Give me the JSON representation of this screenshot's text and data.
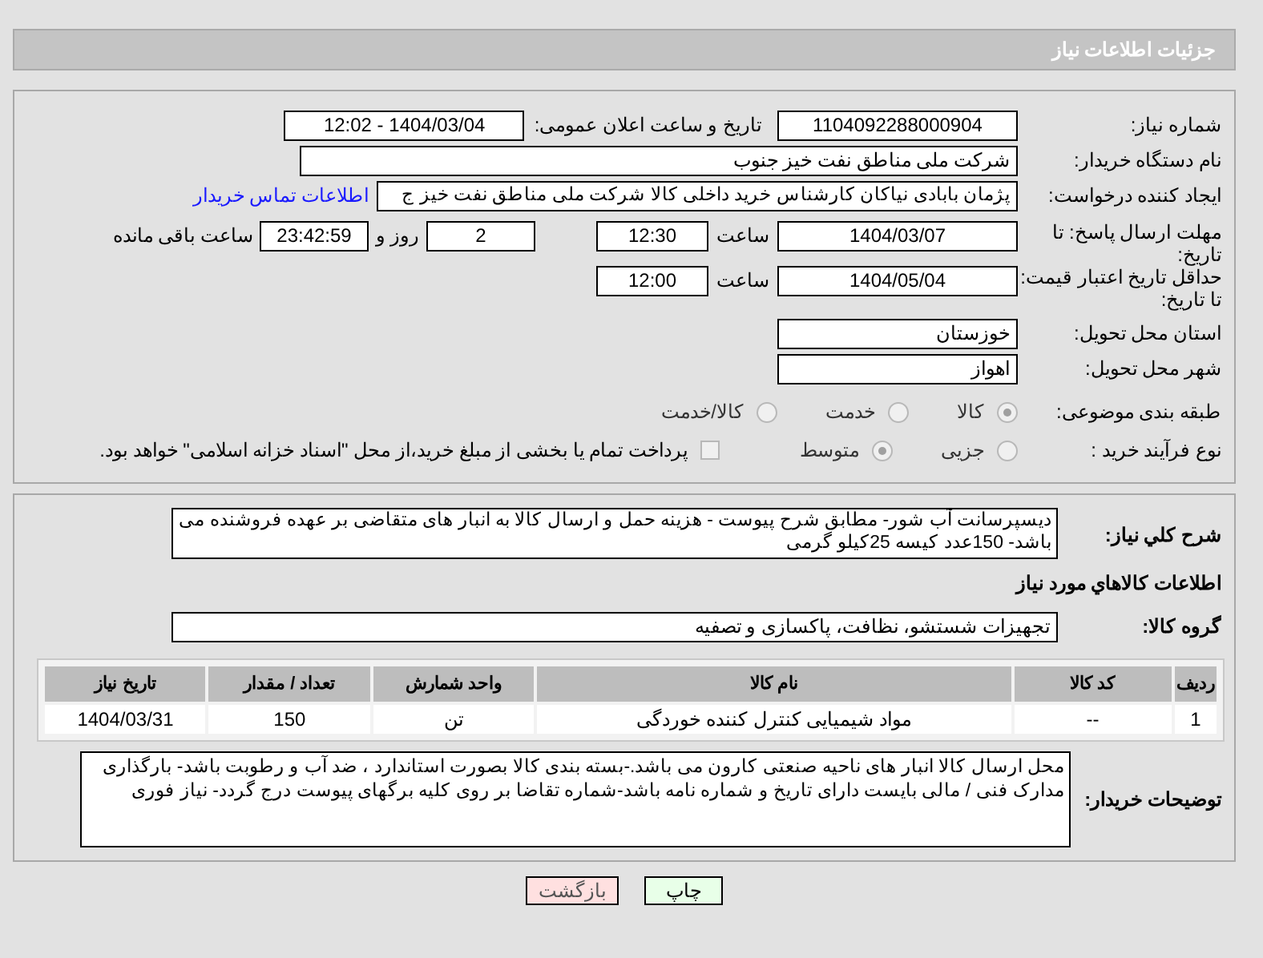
{
  "header": {
    "title": "جزئیات اطلاعات نیاز"
  },
  "need_number": {
    "label": "شماره نیاز:",
    "value": "1104092288000904"
  },
  "announce": {
    "label": "تاریخ و ساعت اعلان عمومی:",
    "value": "1404/03/04 - 12:02"
  },
  "buyer_org": {
    "label": "نام دستگاه خریدار:",
    "value": "شرکت ملی مناطق نفت خیز جنوب"
  },
  "requester": {
    "label": "ایجاد کننده درخواست:",
    "value": "پژمان  بابادی نیاکان  کارشناس خرید داخلی کالا  شرکت ملی مناطق نفت خیز ج",
    "link": "اطلاعات تماس خریدار"
  },
  "reply_deadline": {
    "label": "مهلت ارسال پاسخ: تا تاریخ:",
    "date": "1404/03/07",
    "time_label": "ساعت",
    "time": "12:30",
    "days": "2",
    "days_label": "روز و",
    "remaining": "23:42:59",
    "remaining_label": "ساعت باقی مانده"
  },
  "price_validity": {
    "label": "حداقل تاریخ اعتبار قیمت: تا تاریخ:",
    "date": "1404/05/04",
    "time_label": "ساعت",
    "time": "12:00"
  },
  "province": {
    "label": "استان محل تحویل:",
    "value": "خوزستان"
  },
  "city": {
    "label": "شهر محل تحویل:",
    "value": "اهواز"
  },
  "category": {
    "label": "طبقه بندی موضوعی:",
    "options": [
      {
        "label": "کالا",
        "selected": true
      },
      {
        "label": "خدمت",
        "selected": false
      },
      {
        "label": "کالا/خدمت",
        "selected": false
      }
    ]
  },
  "purchase_process": {
    "label": "نوع فرآیند خرید :",
    "options": [
      {
        "label": "جزیی",
        "selected": false
      },
      {
        "label": "متوسط",
        "selected": true
      }
    ],
    "treasury": {
      "label": "پرداخت تمام یا بخشی از مبلغ خرید،از محل \"اسناد خزانه اسلامی\" خواهد بود.",
      "checked": false
    }
  },
  "description": {
    "label": "شرح کلي نیاز:",
    "value": "دیسپرسانت آب شور- مطابق شرح پیوست -  هزینه حمل و ارسال کالا به انبار های  متقاضی بر عهده فروشنده می باشد- 150عدد کیسه 25کیلو گرمی"
  },
  "goods_title": "اطلاعات کالاهاي مورد نياز",
  "goods_group": {
    "label": "گروه کالا:",
    "value": "تجهیزات شستشو، نظافت، پاکسازی و تصفیه"
  },
  "table": {
    "columns": [
      "ردیف",
      "کد کالا",
      "نام کالا",
      "واحد شمارش",
      "تعداد / مقدار",
      "تاریخ نیاز"
    ],
    "rows": [
      [
        "1",
        "--",
        "مواد شیمیایی کنترل کننده خوردگی",
        "تن",
        "150",
        "1404/03/31"
      ]
    ]
  },
  "buyer_notes": {
    "label": "توضیحات خریدار:",
    "value": "محل ارسال کالا انبار های ناحیه صنعتی کارون می باشد.-بسته بندی کالا بصورت استاندارد ، ضد آب و رطوبت باشد- بارگذاری مدارک  فنی / مالی بایست دارای تاریخ و شماره نامه باشد-شماره تقاضا بر روی کلیه برگهای پیوست درج گردد- نیاز فوری"
  },
  "buttons": [
    {
      "label": "چاپ",
      "kind": "print"
    },
    {
      "label": "بازگشت",
      "kind": "back"
    }
  ]
}
